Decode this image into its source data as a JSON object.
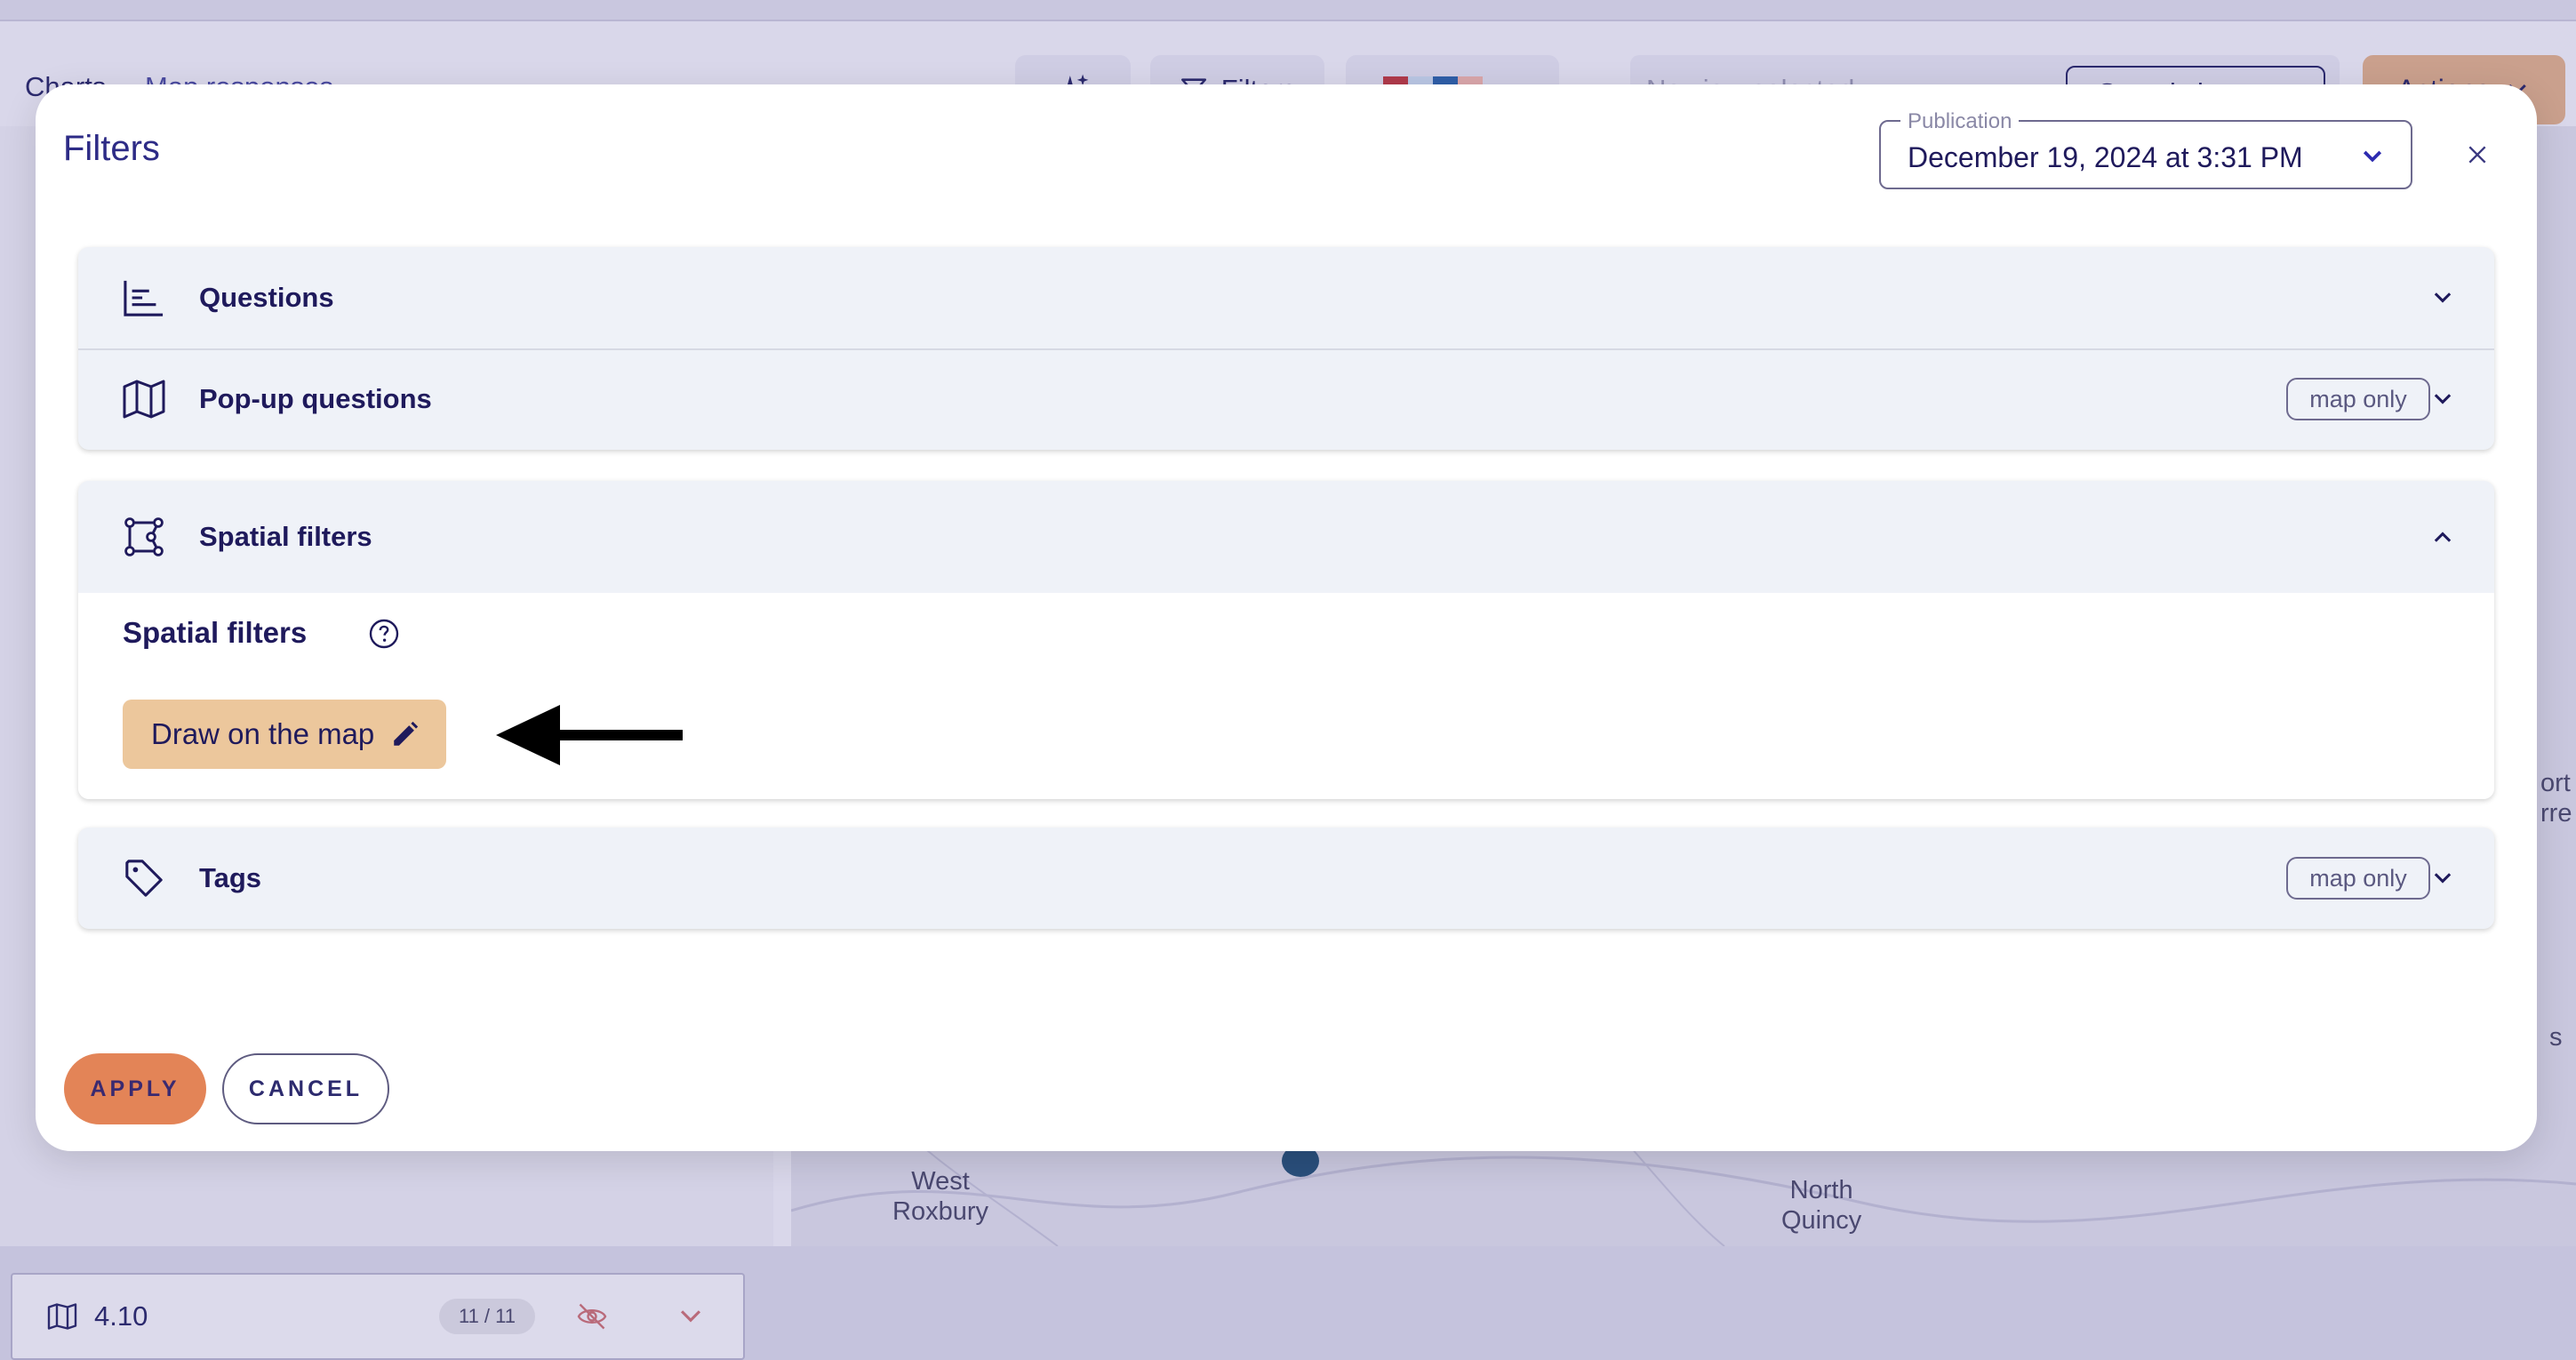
{
  "background": {
    "nav": {
      "charts": "Charts",
      "map_responses": "Map responses"
    },
    "toolbar": {
      "filters_label": "Filters",
      "view_placeholder": "No view selected",
      "saved_views_label": "Saved views",
      "actions_label": "Actions"
    },
    "palette_colors": [
      "#b03a4b",
      "#b9c6e4",
      "#2f5ea8",
      "#d9a6aa"
    ],
    "sidebar_row": {
      "label": "4.10",
      "count": "11 / 11"
    },
    "map_labels": {
      "west_roxbury": "West\nRoxbury",
      "north_quincy": "North\nQuincy",
      "edge_partial_1": "ort",
      "edge_partial_2": "rre",
      "edge_partial_3": "s"
    }
  },
  "modal": {
    "title": "Filters",
    "publication": {
      "legend": "Publication",
      "value": "December 19, 2024 at 3:31 PM"
    },
    "sections": {
      "questions": {
        "label": "Questions"
      },
      "popup": {
        "label": "Pop-up questions",
        "badge": "map only"
      },
      "spatial": {
        "label": "Spatial filters",
        "sub_label": "Spatial filters",
        "draw_button": "Draw on the map"
      },
      "tags": {
        "label": "Tags",
        "badge": "map only"
      }
    },
    "footer": {
      "apply": "APPLY",
      "cancel": "CANCEL"
    }
  },
  "colors": {
    "accent_navy": "#1f1a5c",
    "apply_orange": "#e38457",
    "draw_button_tan": "#ecc79c",
    "panel_bg": "#eff2f8"
  }
}
